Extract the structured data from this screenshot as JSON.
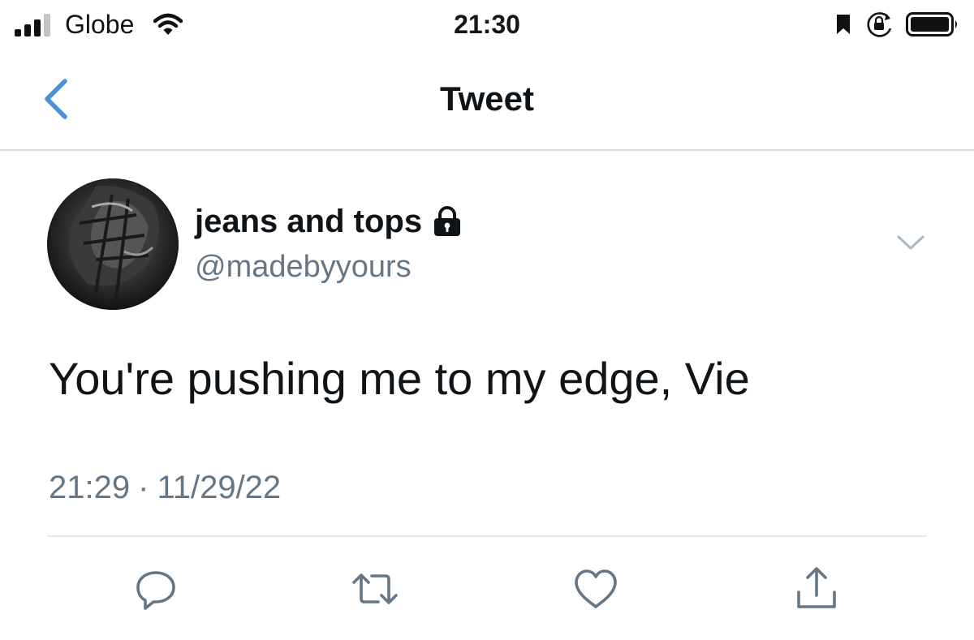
{
  "status_bar": {
    "carrier": "Globe",
    "time": "21:30",
    "icons": [
      "signal-icon",
      "wifi-icon",
      "bookmark-icon",
      "rotation-lock-icon",
      "battery-icon"
    ]
  },
  "nav": {
    "title": "Tweet",
    "back_icon": "chevron-left-icon"
  },
  "tweet": {
    "display_name": "jeans and tops",
    "protected_icon": "lock-icon",
    "handle": "@madebyyours",
    "text": "You're pushing me to my edge, Vie",
    "time": "21:29",
    "separator": "·",
    "date": "11/29/22",
    "more_icon": "chevron-down-icon"
  },
  "actions": [
    "reply-icon",
    "retweet-icon",
    "like-icon",
    "share-icon"
  ],
  "colors": {
    "accent": "#4a90d9",
    "secondary_text": "#657786",
    "icon_gray": "#657786",
    "divider": "#e1e8ed"
  }
}
